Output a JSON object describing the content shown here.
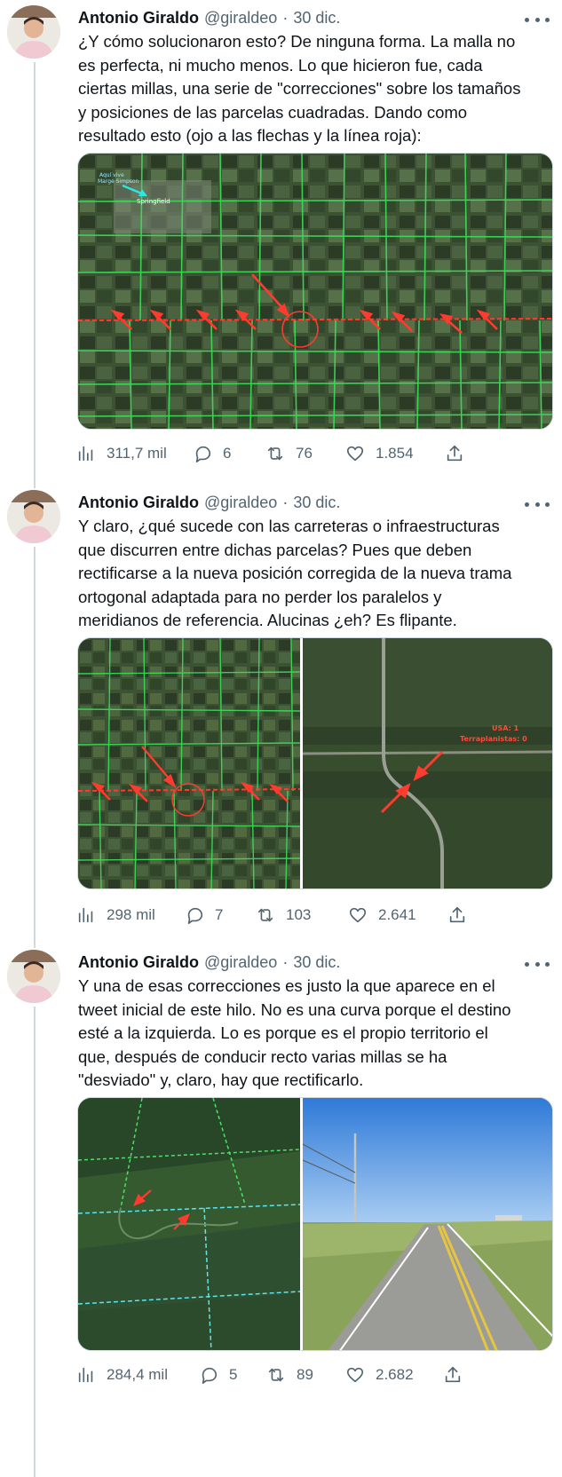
{
  "tweets": [
    {
      "author": "Antonio Giraldo",
      "handle": "@giraldeo",
      "separator": "·",
      "date": "30 dic.",
      "text": "¿Y cómo solucionaron esto? De ninguna forma. La malla no\nes perfecta, ni mucho menos. Lo que hicieron fue, cada\nciertas millas, una serie de \"correcciones\" sobre los tamaños\ny posiciones de las parcelas cuadradas. Dando como\nresultado esto (ojo a las flechas y la línea roja):",
      "media_labels": [
        "Aquí vive\nMarge Simpson",
        "Springfield"
      ],
      "stats": {
        "views": "311,7 mil",
        "replies": "6",
        "retweets": "76",
        "likes": "1.854"
      }
    },
    {
      "author": "Antonio Giraldo",
      "handle": "@giraldeo",
      "separator": "·",
      "date": "30 dic.",
      "text": "Y claro, ¿qué sucede con las carreteras o infraestructuras\nque discurren entre dichas parcelas? Pues que deben\nrectificarse a la nueva posición corregida de la nueva trama\nortogonal adaptada para no perder los paralelos y\nmeridianos de referencia. Alucinas ¿eh? Es flipante.",
      "media_labels": [
        "USA: 1",
        "Terraplanistas: 0"
      ],
      "stats": {
        "views": "298 mil",
        "replies": "7",
        "retweets": "103",
        "likes": "2.641"
      }
    },
    {
      "author": "Antonio Giraldo",
      "handle": "@giraldeo",
      "separator": "·",
      "date": "30 dic.",
      "text": "Y una de esas correcciones es justo la que aparece en el\ntweet inicial de este hilo. No es una curva porque el destino\nesté a la izquierda. Lo es porque es el propio territorio el\nque, después de conducir recto varias millas se ha\n\"desviado\" y, claro, hay que rectificarlo.",
      "stats": {
        "views": "284,4 mil",
        "replies": "5",
        "retweets": "89",
        "likes": "2.682"
      }
    }
  ],
  "icons": {
    "views": "bar-chart-icon",
    "replies": "reply-bubble-icon",
    "retweets": "retweet-icon",
    "likes": "heart-icon",
    "share": "share-upload-icon",
    "more": "more-dots-icon"
  },
  "colors": {
    "text_primary": "#0f1419",
    "text_secondary": "#536471",
    "thread_line": "#cfd9de",
    "grid_green": "#3be05a",
    "correction_red": "#ff3b2f"
  }
}
